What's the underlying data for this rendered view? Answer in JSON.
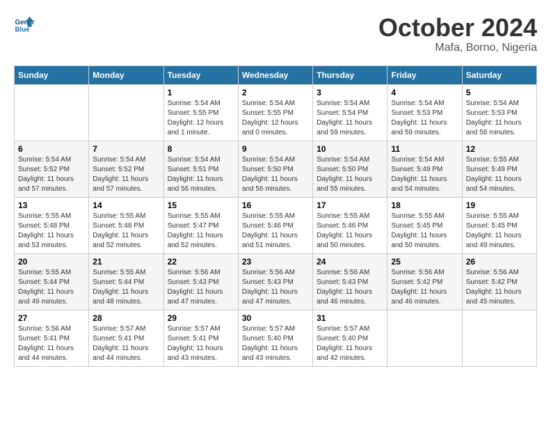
{
  "logo": {
    "line1": "General",
    "line2": "Blue"
  },
  "title": "October 2024",
  "subtitle": "Mafa, Borno, Nigeria",
  "days_of_week": [
    "Sunday",
    "Monday",
    "Tuesday",
    "Wednesday",
    "Thursday",
    "Friday",
    "Saturday"
  ],
  "weeks": [
    [
      {
        "num": "",
        "info": ""
      },
      {
        "num": "",
        "info": ""
      },
      {
        "num": "1",
        "info": "Sunrise: 5:54 AM\nSunset: 5:55 PM\nDaylight: 12 hours\nand 1 minute."
      },
      {
        "num": "2",
        "info": "Sunrise: 5:54 AM\nSunset: 5:55 PM\nDaylight: 12 hours\nand 0 minutes."
      },
      {
        "num": "3",
        "info": "Sunrise: 5:54 AM\nSunset: 5:54 PM\nDaylight: 11 hours\nand 59 minutes."
      },
      {
        "num": "4",
        "info": "Sunrise: 5:54 AM\nSunset: 5:53 PM\nDaylight: 11 hours\nand 59 minutes."
      },
      {
        "num": "5",
        "info": "Sunrise: 5:54 AM\nSunset: 5:53 PM\nDaylight: 11 hours\nand 58 minutes."
      }
    ],
    [
      {
        "num": "6",
        "info": "Sunrise: 5:54 AM\nSunset: 5:52 PM\nDaylight: 11 hours\nand 57 minutes."
      },
      {
        "num": "7",
        "info": "Sunrise: 5:54 AM\nSunset: 5:52 PM\nDaylight: 11 hours\nand 57 minutes."
      },
      {
        "num": "8",
        "info": "Sunrise: 5:54 AM\nSunset: 5:51 PM\nDaylight: 11 hours\nand 56 minutes."
      },
      {
        "num": "9",
        "info": "Sunrise: 5:54 AM\nSunset: 5:50 PM\nDaylight: 11 hours\nand 56 minutes."
      },
      {
        "num": "10",
        "info": "Sunrise: 5:54 AM\nSunset: 5:50 PM\nDaylight: 11 hours\nand 55 minutes."
      },
      {
        "num": "11",
        "info": "Sunrise: 5:54 AM\nSunset: 5:49 PM\nDaylight: 11 hours\nand 54 minutes."
      },
      {
        "num": "12",
        "info": "Sunrise: 5:55 AM\nSunset: 5:49 PM\nDaylight: 11 hours\nand 54 minutes."
      }
    ],
    [
      {
        "num": "13",
        "info": "Sunrise: 5:55 AM\nSunset: 5:48 PM\nDaylight: 11 hours\nand 53 minutes."
      },
      {
        "num": "14",
        "info": "Sunrise: 5:55 AM\nSunset: 5:48 PM\nDaylight: 11 hours\nand 52 minutes."
      },
      {
        "num": "15",
        "info": "Sunrise: 5:55 AM\nSunset: 5:47 PM\nDaylight: 11 hours\nand 52 minutes."
      },
      {
        "num": "16",
        "info": "Sunrise: 5:55 AM\nSunset: 5:46 PM\nDaylight: 11 hours\nand 51 minutes."
      },
      {
        "num": "17",
        "info": "Sunrise: 5:55 AM\nSunset: 5:46 PM\nDaylight: 11 hours\nand 50 minutes."
      },
      {
        "num": "18",
        "info": "Sunrise: 5:55 AM\nSunset: 5:45 PM\nDaylight: 11 hours\nand 50 minutes."
      },
      {
        "num": "19",
        "info": "Sunrise: 5:55 AM\nSunset: 5:45 PM\nDaylight: 11 hours\nand 49 minutes."
      }
    ],
    [
      {
        "num": "20",
        "info": "Sunrise: 5:55 AM\nSunset: 5:44 PM\nDaylight: 11 hours\nand 49 minutes."
      },
      {
        "num": "21",
        "info": "Sunrise: 5:55 AM\nSunset: 5:44 PM\nDaylight: 11 hours\nand 48 minutes."
      },
      {
        "num": "22",
        "info": "Sunrise: 5:56 AM\nSunset: 5:43 PM\nDaylight: 11 hours\nand 47 minutes."
      },
      {
        "num": "23",
        "info": "Sunrise: 5:56 AM\nSunset: 5:43 PM\nDaylight: 11 hours\nand 47 minutes."
      },
      {
        "num": "24",
        "info": "Sunrise: 5:56 AM\nSunset: 5:43 PM\nDaylight: 11 hours\nand 46 minutes."
      },
      {
        "num": "25",
        "info": "Sunrise: 5:56 AM\nSunset: 5:42 PM\nDaylight: 11 hours\nand 46 minutes."
      },
      {
        "num": "26",
        "info": "Sunrise: 5:56 AM\nSunset: 5:42 PM\nDaylight: 11 hours\nand 45 minutes."
      }
    ],
    [
      {
        "num": "27",
        "info": "Sunrise: 5:56 AM\nSunset: 5:41 PM\nDaylight: 11 hours\nand 44 minutes."
      },
      {
        "num": "28",
        "info": "Sunrise: 5:57 AM\nSunset: 5:41 PM\nDaylight: 11 hours\nand 44 minutes."
      },
      {
        "num": "29",
        "info": "Sunrise: 5:57 AM\nSunset: 5:41 PM\nDaylight: 11 hours\nand 43 minutes."
      },
      {
        "num": "30",
        "info": "Sunrise: 5:57 AM\nSunset: 5:40 PM\nDaylight: 11 hours\nand 43 minutes."
      },
      {
        "num": "31",
        "info": "Sunrise: 5:57 AM\nSunset: 5:40 PM\nDaylight: 11 hours\nand 42 minutes."
      },
      {
        "num": "",
        "info": ""
      },
      {
        "num": "",
        "info": ""
      }
    ]
  ]
}
